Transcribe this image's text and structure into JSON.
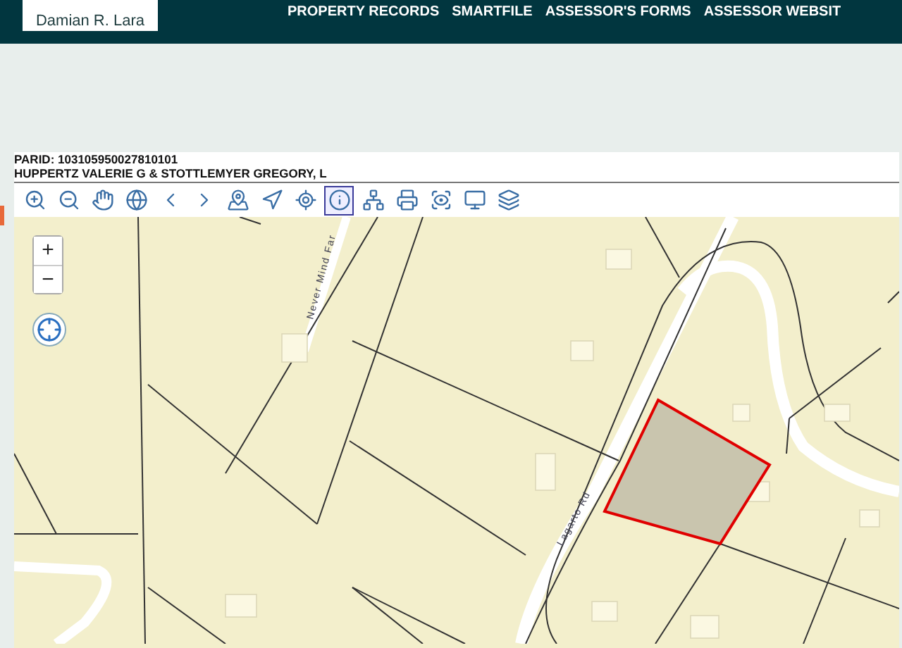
{
  "header": {
    "logo_name": "Damian R. Lara",
    "nav": [
      "PROPERTY RECORDS",
      "SMARTFILE",
      "ASSESSOR'S FORMS",
      "ASSESSOR WEBSIT"
    ]
  },
  "parcel": {
    "parid": "PARID: 103105950027810101",
    "owner": "HUPPERTZ VALERIE G & STOTTLEMYER GREGORY, L"
  },
  "toolbar": [
    {
      "kind": "zoom-in",
      "selected": false
    },
    {
      "kind": "zoom-out",
      "selected": false
    },
    {
      "kind": "pan",
      "selected": false
    },
    {
      "kind": "globe",
      "selected": false
    },
    {
      "kind": "back",
      "selected": false
    },
    {
      "kind": "forward",
      "selected": false
    },
    {
      "kind": "map-pin",
      "selected": false
    },
    {
      "kind": "select",
      "selected": false
    },
    {
      "kind": "locate",
      "selected": false
    },
    {
      "kind": "info",
      "selected": true
    },
    {
      "kind": "network",
      "selected": false
    },
    {
      "kind": "print",
      "selected": false
    },
    {
      "kind": "print-preview",
      "selected": false
    },
    {
      "kind": "screen",
      "selected": false
    },
    {
      "kind": "layers",
      "selected": false
    }
  ],
  "map": {
    "zoom_in": "+",
    "zoom_out": "−",
    "road_labels": [
      "Never Mind Far",
      "Lagarto Rd"
    ]
  }
}
